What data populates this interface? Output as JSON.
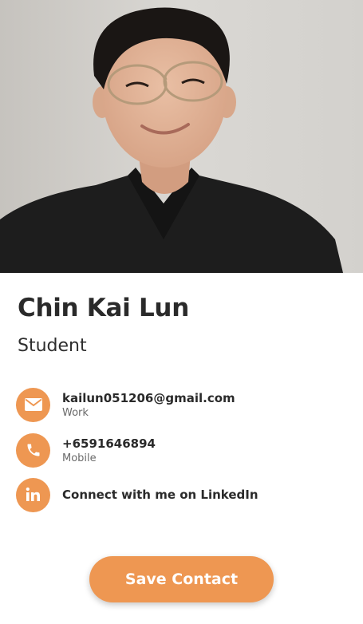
{
  "profile": {
    "name": "Chin Kai Lun",
    "title": "Student"
  },
  "contacts": [
    {
      "icon": "envelope-icon",
      "primary": "kailun051206@gmail.com",
      "secondary": "Work"
    },
    {
      "icon": "phone-icon",
      "primary": "+6591646894",
      "secondary": "Mobile"
    },
    {
      "icon": "linkedin-icon",
      "primary": "Connect with me on LinkedIn",
      "secondary": ""
    }
  ],
  "actions": {
    "save_label": "Save Contact"
  },
  "colors": {
    "accent": "#ee9752",
    "text": "#2a2a2a",
    "muted": "#6a6a6a"
  }
}
